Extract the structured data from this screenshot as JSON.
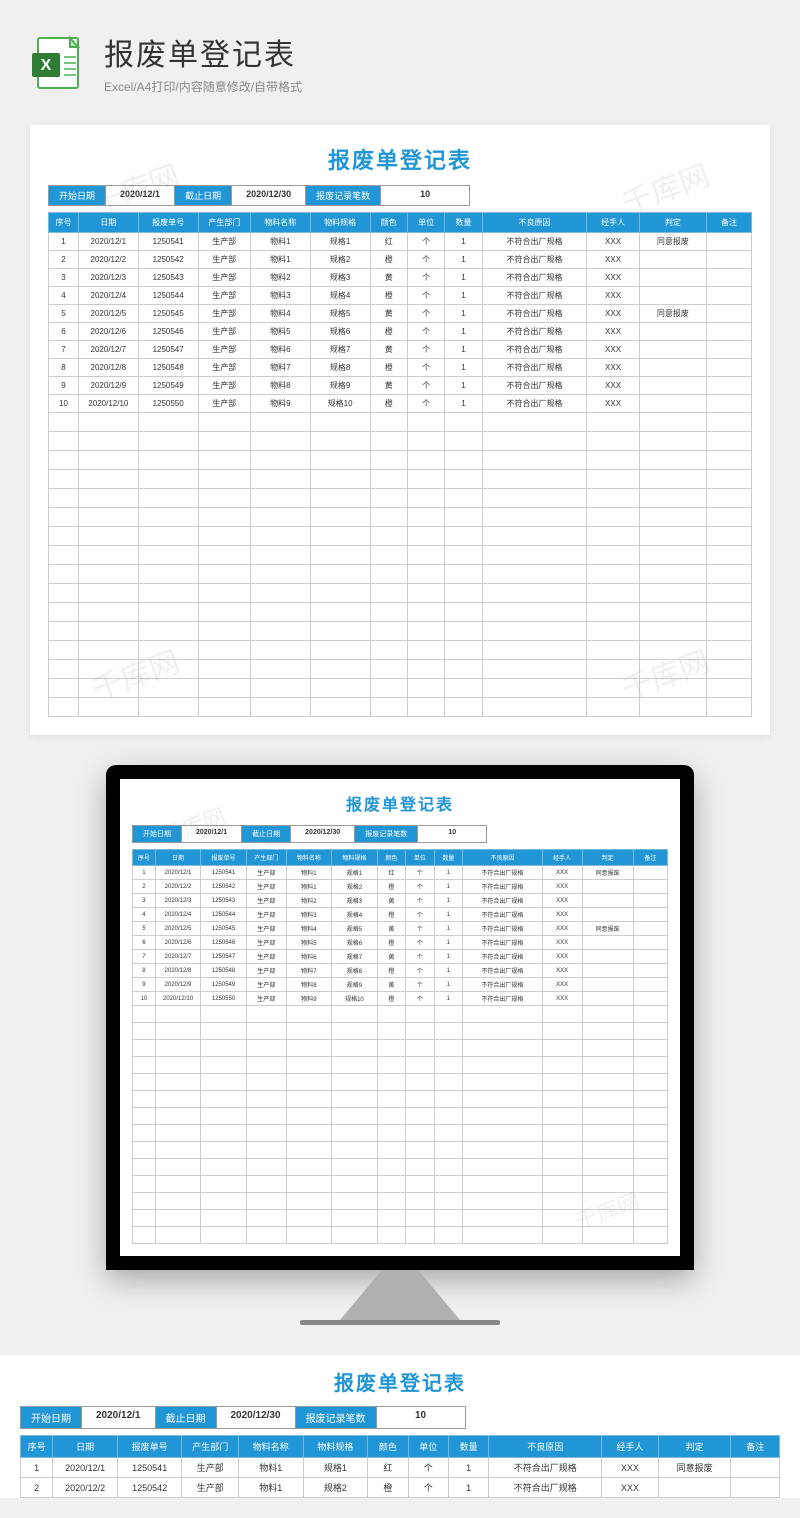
{
  "header": {
    "title": "报废单登记表",
    "subtitle": "Excel/A4打印/内容随意修改/自带格式"
  },
  "sheet": {
    "title": "报废单登记表",
    "filters": {
      "start_label": "开始日期",
      "start_value": "2020/12/1",
      "end_label": "截止日期",
      "end_value": "2020/12/30",
      "count_label": "报废记录笔数",
      "count_value": "10"
    },
    "columns": [
      "序号",
      "日期",
      "报废单号",
      "产生部门",
      "物料名称",
      "物料规格",
      "颜色",
      "单位",
      "数量",
      "不良原因",
      "经手人",
      "判定",
      "备注"
    ],
    "rows": [
      [
        "1",
        "2020/12/1",
        "1250541",
        "生产部",
        "物料1",
        "规格1",
        "红",
        "个",
        "1",
        "不符合出厂规格",
        "XXX",
        "同意报废",
        ""
      ],
      [
        "2",
        "2020/12/2",
        "1250542",
        "生产部",
        "物料1",
        "规格2",
        "橙",
        "个",
        "1",
        "不符合出厂规格",
        "XXX",
        "",
        ""
      ],
      [
        "3",
        "2020/12/3",
        "1250543",
        "生产部",
        "物料2",
        "规格3",
        "黄",
        "个",
        "1",
        "不符合出厂规格",
        "XXX",
        "",
        ""
      ],
      [
        "4",
        "2020/12/4",
        "1250544",
        "生产部",
        "物料3",
        "规格4",
        "橙",
        "个",
        "1",
        "不符合出厂规格",
        "XXX",
        "",
        ""
      ],
      [
        "5",
        "2020/12/5",
        "1250545",
        "生产部",
        "物料4",
        "规格5",
        "黄",
        "个",
        "1",
        "不符合出厂规格",
        "XXX",
        "同意报废",
        ""
      ],
      [
        "6",
        "2020/12/6",
        "1250546",
        "生产部",
        "物料5",
        "规格6",
        "橙",
        "个",
        "1",
        "不符合出厂规格",
        "XXX",
        "",
        ""
      ],
      [
        "7",
        "2020/12/7",
        "1250547",
        "生产部",
        "物料6",
        "规格7",
        "黄",
        "个",
        "1",
        "不符合出厂规格",
        "XXX",
        "",
        ""
      ],
      [
        "8",
        "2020/12/8",
        "1250548",
        "生产部",
        "物料7",
        "规格8",
        "橙",
        "个",
        "1",
        "不符合出厂规格",
        "XXX",
        "",
        ""
      ],
      [
        "9",
        "2020/12/9",
        "1250549",
        "生产部",
        "物料8",
        "规格9",
        "黄",
        "个",
        "1",
        "不符合出厂规格",
        "XXX",
        "",
        ""
      ],
      [
        "10",
        "2020/12/10",
        "1250550",
        "生产部",
        "物料9",
        "规格10",
        "橙",
        "个",
        "1",
        "不符合出厂规格",
        "XXX",
        "",
        ""
      ]
    ]
  },
  "watermark": "千库网"
}
